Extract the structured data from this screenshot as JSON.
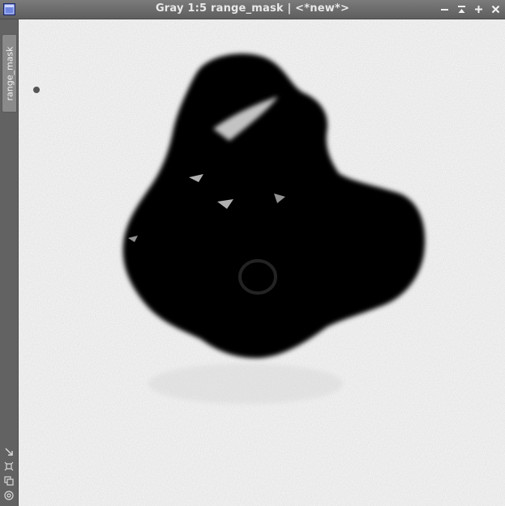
{
  "window": {
    "title": "Gray 1:5 range_mask | <*new*>",
    "controls": [
      "shade-icon",
      "minimize-icon",
      "maximize-icon",
      "close-icon"
    ]
  },
  "sidebar": {
    "tab_label": "range_mask",
    "tools": [
      "zoom-fit-icon",
      "pan-icon",
      "clone-icon",
      "target-icon"
    ]
  },
  "image": {
    "description_colors": {
      "background": "#ffffff",
      "mask": "#000000"
    }
  },
  "colors": {
    "titlebar": "#6a6a6a",
    "title_text": "#e8e8e8",
    "tab": "#8a8a8a",
    "accent_icon": "#3a4fb0"
  }
}
